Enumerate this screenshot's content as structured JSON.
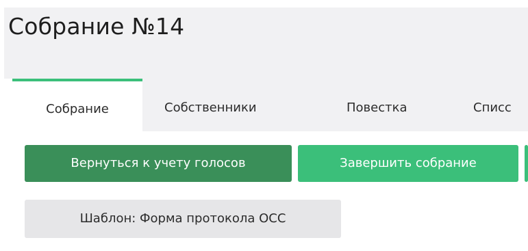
{
  "page": {
    "title": "Собрание №14"
  },
  "tabs": [
    {
      "label": "Собрание",
      "active": true
    },
    {
      "label": "Собственники",
      "active": false
    },
    {
      "label": "Повестка",
      "active": false
    },
    {
      "label": "Списс",
      "active": false
    }
  ],
  "actions": {
    "return_label": "Вернуться к учету голосов",
    "finish_label": "Завершить собрание"
  },
  "template": {
    "label": "Шаблон: Форма протокола ОСС"
  },
  "colors": {
    "accent": "#3bbf7a",
    "dark_green": "#3a8f59",
    "header_bg": "#f1f1f3",
    "template_bg": "#e6e6e8"
  }
}
